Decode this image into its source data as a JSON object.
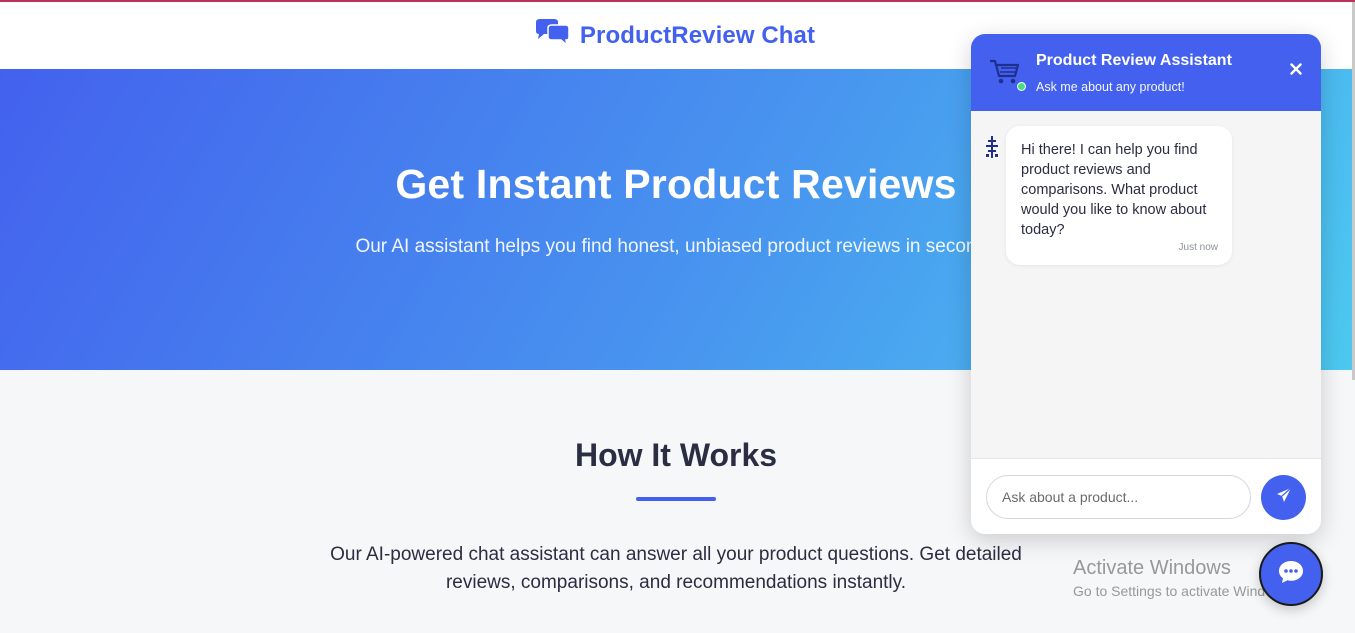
{
  "header": {
    "brand_name": "ProductReview Chat",
    "brand_icon": "comments-icon"
  },
  "hero": {
    "title": "Get Instant Product Reviews",
    "subtitle": "Our AI assistant helps you find honest, unbiased product reviews in seconds"
  },
  "how_it_works": {
    "title": "How It Works",
    "description": "Our AI-powered chat assistant can answer all your product questions. Get detailed reviews, comparisons, and recommendations instantly."
  },
  "chat": {
    "title": "Product Review Assistant",
    "subtitle": "Ask me about any product!",
    "header_icon": "shopping-cart-icon",
    "close_icon": "close-icon",
    "messages": [
      {
        "sender": "bot",
        "avatar_icon": "robot-icon",
        "text": "Hi there! I can help you find product reviews and comparisons. What product would you like to know about today?",
        "time": "Just now"
      }
    ],
    "input_placeholder": "Ask about a product...",
    "input_value": "",
    "send_icon": "paper-plane-icon"
  },
  "launcher": {
    "icon": "chat-bubble-icon"
  },
  "watermark": {
    "title": "Activate Windows",
    "subtitle": "Go to Settings to activate Windows."
  },
  "colors": {
    "primary": "#4361ee",
    "gradient_mid": "#4895ef",
    "gradient_end": "#4cc9f0",
    "dark_text": "#2b2d42",
    "status_online": "#4ade80"
  }
}
